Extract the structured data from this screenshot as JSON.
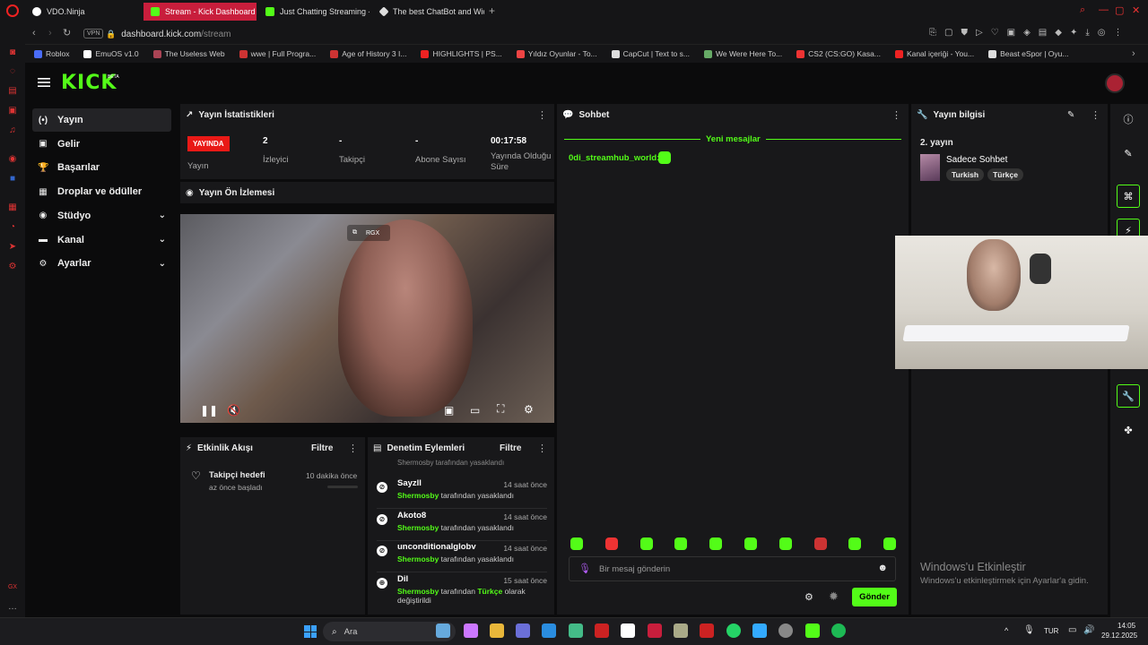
{
  "browser": {
    "tabs": [
      {
        "title": "VDO.Ninja",
        "active": false
      },
      {
        "title": "Stream - Kick Dashboard",
        "active": true
      },
      {
        "title": "Just Chatting Streaming -",
        "active": false
      },
      {
        "title": "The best ChatBot and Wid",
        "active": false
      }
    ],
    "new_tab_label": "+",
    "url_host": "dashboard.kick.com",
    "url_path": "/stream",
    "vpn_label": "VPN",
    "bookmarks": [
      "Roblox",
      "EmuOS v1.0",
      "The Useless Web",
      "wwe | Full Progra...",
      "Age of History 3 I...",
      "HIGHLIGHTS | PS...",
      "Yıldız Oyunlar - To...",
      "CapCut | Text to s...",
      "We Were Here To...",
      "CS2 (CS:GO) Kasa...",
      "Kanal içeriği - You...",
      "Beast eSpor | Oyu..."
    ]
  },
  "kick": {
    "logo": "KICK",
    "beta": "BETA",
    "nav": [
      {
        "label": "Yayın",
        "icon": "(•)",
        "active": true,
        "chevron": false
      },
      {
        "label": "Gelir",
        "icon": "▣",
        "active": false,
        "chevron": false
      },
      {
        "label": "Başarılar",
        "icon": "🏆",
        "active": false,
        "chevron": false
      },
      {
        "label": "Droplar ve ödüller",
        "icon": "▦",
        "active": false,
        "chevron": false
      },
      {
        "label": "Stüdyo",
        "icon": "◉",
        "active": false,
        "chevron": true
      },
      {
        "label": "Kanal",
        "icon": "▬",
        "active": false,
        "chevron": true
      },
      {
        "label": "Ayarlar",
        "icon": "⚙",
        "active": false,
        "chevron": true
      }
    ],
    "stats_panel": {
      "title": "Yayın İstatistikleri",
      "live_badge": "YAYINDA",
      "live_label": "Yayın",
      "items": [
        {
          "value": "2",
          "label": "İzleyici"
        },
        {
          "value": "-",
          "label": "Takipçi"
        },
        {
          "value": "-",
          "label": "Abone Sayısı"
        },
        {
          "value": "00:17:58",
          "label": "Yayında Olduğu Süre"
        }
      ]
    },
    "preview": {
      "title": "Yayın Ön İzlemesi",
      "overlay_label": "RGX"
    },
    "activity": {
      "title": "Etkinlik Akışı",
      "filter": "Filtre",
      "item_title": "Takipçi hedefi",
      "item_sub": "az önce başladı",
      "item_time": "10 dakika önce"
    },
    "moderation": {
      "title": "Denetim Eylemleri",
      "filter": "Filtre",
      "partial_top": "Shermosby tarafından yasaklandı",
      "rows": [
        {
          "name": "Sayzll",
          "time": "14 saat önce",
          "by": "Shermosby",
          "action": "tarafından yasaklandı",
          "icon": "ban"
        },
        {
          "name": "Akoto8",
          "time": "14 saat önce",
          "by": "Shermosby",
          "action": "tarafından yasaklandı",
          "icon": "ban"
        },
        {
          "name": "unconditionalglobv",
          "time": "14 saat önce",
          "by": "Shermosby",
          "action": "tarafından yasaklandı",
          "icon": "ban"
        },
        {
          "name": "Dil",
          "time": "15 saat önce",
          "by": "Shermosby",
          "action_pre": "tarafından",
          "lang": "Türkçe",
          "action_post": "olarak değiştirildi",
          "icon": "globe"
        }
      ]
    },
    "chat": {
      "title": "Sohbet",
      "divider": "Yeni mesajlar",
      "message_user": "0di_streamhub_world:",
      "input_placeholder": "Bir mesaj gönderin",
      "send": "Gönder"
    },
    "stream_info": {
      "title": "Yayın bilgisi",
      "stream_title": "2. yayın",
      "category": "Sadece Sohbet",
      "tags": [
        "Turkish",
        "Türkçe"
      ]
    },
    "watermark": {
      "title": "Windows'u Etkinleştir",
      "sub": "Windows'u etkinleştirmek için Ayarlar'a gidin."
    }
  },
  "taskbar": {
    "search": "Ara",
    "lang": "TUR",
    "time": "14:05",
    "date": "29.12.2025"
  },
  "colors": {
    "accent": "#53fc18",
    "live": "#e91916",
    "opera": "#c81e3c"
  }
}
